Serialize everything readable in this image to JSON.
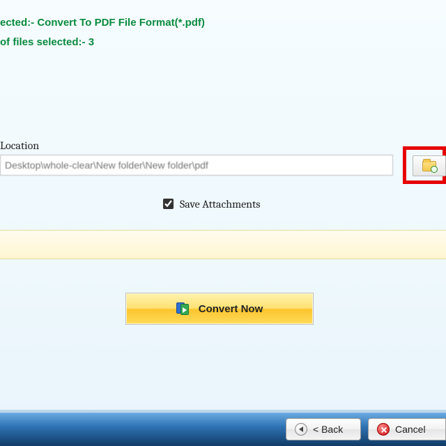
{
  "info": {
    "format_line": "ected:- Convert To PDF File Format(*.pdf)",
    "count_line": "of files selected:- 3"
  },
  "location": {
    "label": "Location",
    "path": "Desktop\\whole-clear\\New folder\\New folder\\pdf"
  },
  "options": {
    "save_attachments_label": "Save Attachments",
    "save_attachments_checked": true
  },
  "actions": {
    "convert_label": "Convert Now"
  },
  "footer": {
    "back_label": "< Back",
    "cancel_label": "Cancel"
  },
  "colors": {
    "accent_green": "#0b8a3e",
    "highlight_red": "#e60000",
    "button_gold": "#fbc52e",
    "footer_blue": "#2f74b5"
  }
}
